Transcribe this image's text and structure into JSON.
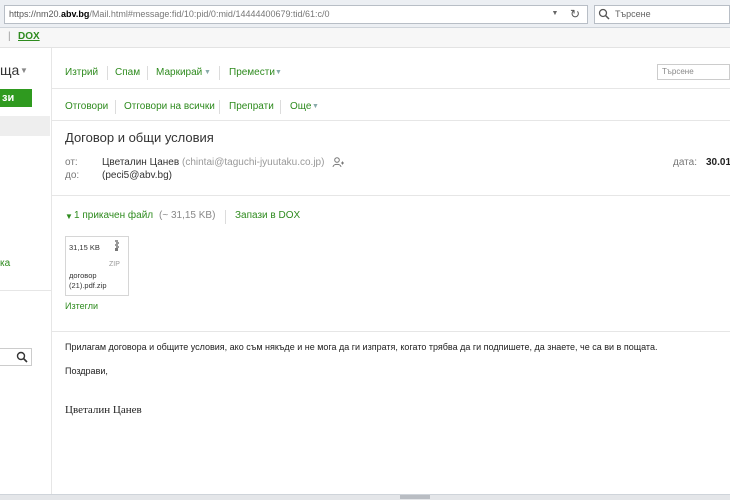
{
  "browser": {
    "url_prefix": "https://nm20.",
    "url_domain": "abv.bg",
    "url_path": "/Mail.html#message:fid/10:pid/0:mid/14444400679:tid/61:c/0",
    "search_placeholder": "Търсене"
  },
  "topbar": {
    "sep": "|",
    "dox": "DOX"
  },
  "sidebar": {
    "folder_title": "ща",
    "write_label": "зи",
    "link_label": "ка"
  },
  "toolbar1": {
    "delete": "Изтрий",
    "spam": "Спам",
    "mark": "Маркирай",
    "move": "Премести",
    "search_placeholder": "Търсене"
  },
  "toolbar2": {
    "reply": "Отговори",
    "reply_all": "Отговори на всички",
    "forward": "Препрати",
    "more": "Още"
  },
  "message": {
    "subject": "Договор и общи условия",
    "from_label": "от:",
    "from_name": "Цветалин Цанев",
    "from_email": "(chintai@taguchi-jyuutaku.co.jp)",
    "to_label": "до:",
    "to_value": "(peci5@abv.bg)",
    "date_label": "дата:",
    "date_value": "30.01"
  },
  "attachment": {
    "count_label": "1 прикачен файл",
    "total_size": "(~ 31,15 KB)",
    "save_dox": "Запази в DOX",
    "file_size": "31,15 KB",
    "file_type": "ZIP",
    "file_name_line1": "договор",
    "file_name_line2": "(21).pdf.zip",
    "download": "Изтегли"
  },
  "body": {
    "p1": "Прилагам договора и общите условия, ако съм някъде и не мога да ги изпратя, когато трябва да ги подпишете, да знаете, че са ви в пощата.",
    "p2": "Поздрави,",
    "signature": "Цветалин Цанев"
  },
  "colors": {
    "accent": "#2e8b1e",
    "button": "#2f9a1f"
  }
}
